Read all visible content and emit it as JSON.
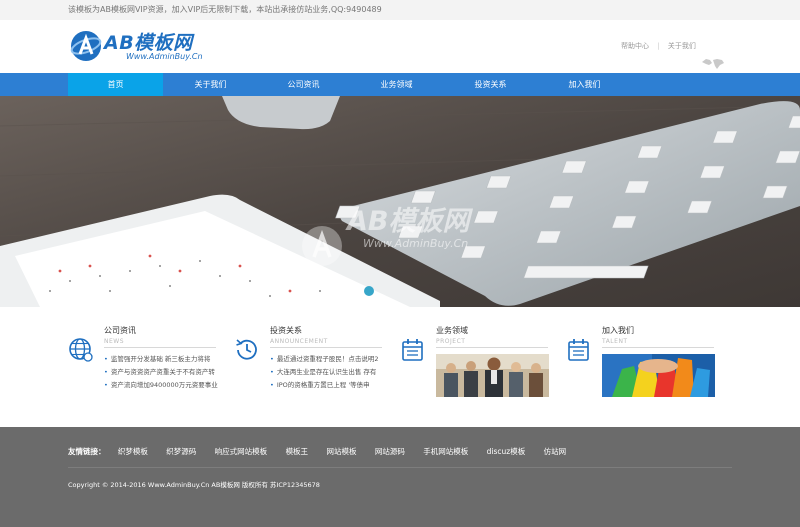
{
  "topbar": {
    "notice": "该模板为AB模板网VIP资源，加入VIP后无限制下载，本站出承接仿站业务,QQ:9490489"
  },
  "header": {
    "logo_text": "AB模板网",
    "logo_sub": "Www.AdminBuy.Cn",
    "links": [
      "帮助中心",
      "关于我们"
    ]
  },
  "nav": {
    "items": [
      "首页",
      "关于我们",
      "公司资讯",
      "业务领域",
      "投资关系",
      "加入我们"
    ],
    "active_index": 0
  },
  "banner": {
    "watermark_text": "AB模板网",
    "watermark_sub": "Www.AdminBuy.Cn"
  },
  "sections": [
    {
      "title": "公司资讯",
      "sub": "NEWS",
      "icon": "globe-icon",
      "items": [
        "监管强开分发基础 新三板主力将将",
        "资产与资资资产资重关于不有资产转",
        "资产流向增加9400000万元资要事业"
      ]
    },
    {
      "title": "投资关系",
      "sub": "ANNOUNCEMENT",
      "icon": "clock-icon",
      "items": [
        "最近通过资重程子股民！点击说明2",
        "大连两生业是存在认识生出售 存有",
        "IPO的资格重方置已上程 '等债申"
      ]
    },
    {
      "title": "业务领域",
      "sub": "PROJECT",
      "icon": "calendar-icon",
      "image": "business-team-photo"
    },
    {
      "title": "加入我们",
      "sub": "TALENT",
      "icon": "calendar-icon",
      "image": "hands-teamwork-photo"
    }
  ],
  "footer": {
    "links_label": "友情链接：",
    "links": [
      "织梦模板",
      "织梦源码",
      "响应式网站模板",
      "模板王",
      "网站模板",
      "网站源码",
      "手机网站模板",
      "discuz模板",
      "仿站网"
    ],
    "copyright": "Copyright © 2014-2016 Www.AdminBuy.Cn AB模板网 版权所有 苏ICP12345678"
  },
  "colors": {
    "nav": "#2d7fd3",
    "nav_active": "#0aa3e8",
    "brand": "#1f6fc0",
    "footer": "#6b6b6b"
  }
}
